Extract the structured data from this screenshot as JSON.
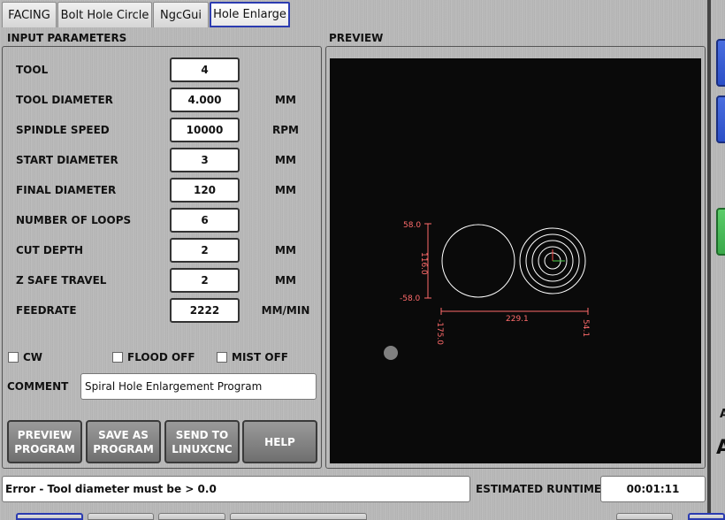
{
  "tabs": [
    {
      "label": "FACING"
    },
    {
      "label": "Bolt Hole Circle"
    },
    {
      "label": "NgcGui"
    },
    {
      "label": "Hole Enlarge"
    }
  ],
  "input_section": {
    "title": "INPUT PARAMETERS"
  },
  "preview_section": {
    "title": "PREVIEW"
  },
  "params": [
    {
      "label": "TOOL",
      "value": "4",
      "unit": ""
    },
    {
      "label": "TOOL DIAMETER",
      "value": "4.000",
      "unit": "MM"
    },
    {
      "label": "SPINDLE SPEED",
      "value": "10000",
      "unit": "RPM"
    },
    {
      "label": "START DIAMETER",
      "value": "3",
      "unit": "MM"
    },
    {
      "label": "FINAL DIAMETER",
      "value": "120",
      "unit": "MM"
    },
    {
      "label": "NUMBER OF LOOPS",
      "value": "6",
      "unit": ""
    },
    {
      "label": "CUT DEPTH",
      "value": "2",
      "unit": "MM"
    },
    {
      "label": "Z SAFE TRAVEL",
      "value": "2",
      "unit": "MM"
    },
    {
      "label": "FEEDRATE",
      "value": "2222",
      "unit": "MM/MIN"
    }
  ],
  "checkboxes": [
    {
      "label": "CW"
    },
    {
      "label": "FLOOD OFF"
    },
    {
      "label": "MIST OFF"
    }
  ],
  "comment": {
    "label": "COMMENT",
    "value": "Spiral Hole Enlargement Program"
  },
  "buttons": {
    "preview": [
      "PREVIEW",
      "PROGRAM"
    ],
    "save": [
      "SAVE AS",
      "PROGRAM"
    ],
    "send": [
      "SEND TO",
      "LINUXCNC"
    ],
    "help": "HELP"
  },
  "preview_dims": {
    "top": "58.0",
    "bottom": "-58.0",
    "height": "116.0",
    "width": "229.1",
    "left": "-175.0",
    "right": "54.1"
  },
  "status": {
    "message": "Error - Tool diameter must be > 0.0",
    "runtime_label": "ESTIMATED RUNTIME",
    "runtime_value": "00:01:11"
  },
  "right_edge_letter": "A",
  "colors": {
    "active_tab_border": "#2b3bb0",
    "preview_bg": "#0a0a0a",
    "dim_lines": "#ff6b6b",
    "toolpath": "#ffffff",
    "origin_marker": "#808080",
    "side_button_blue": "#2b4fc7",
    "side_button_green": "#3aa84a"
  }
}
